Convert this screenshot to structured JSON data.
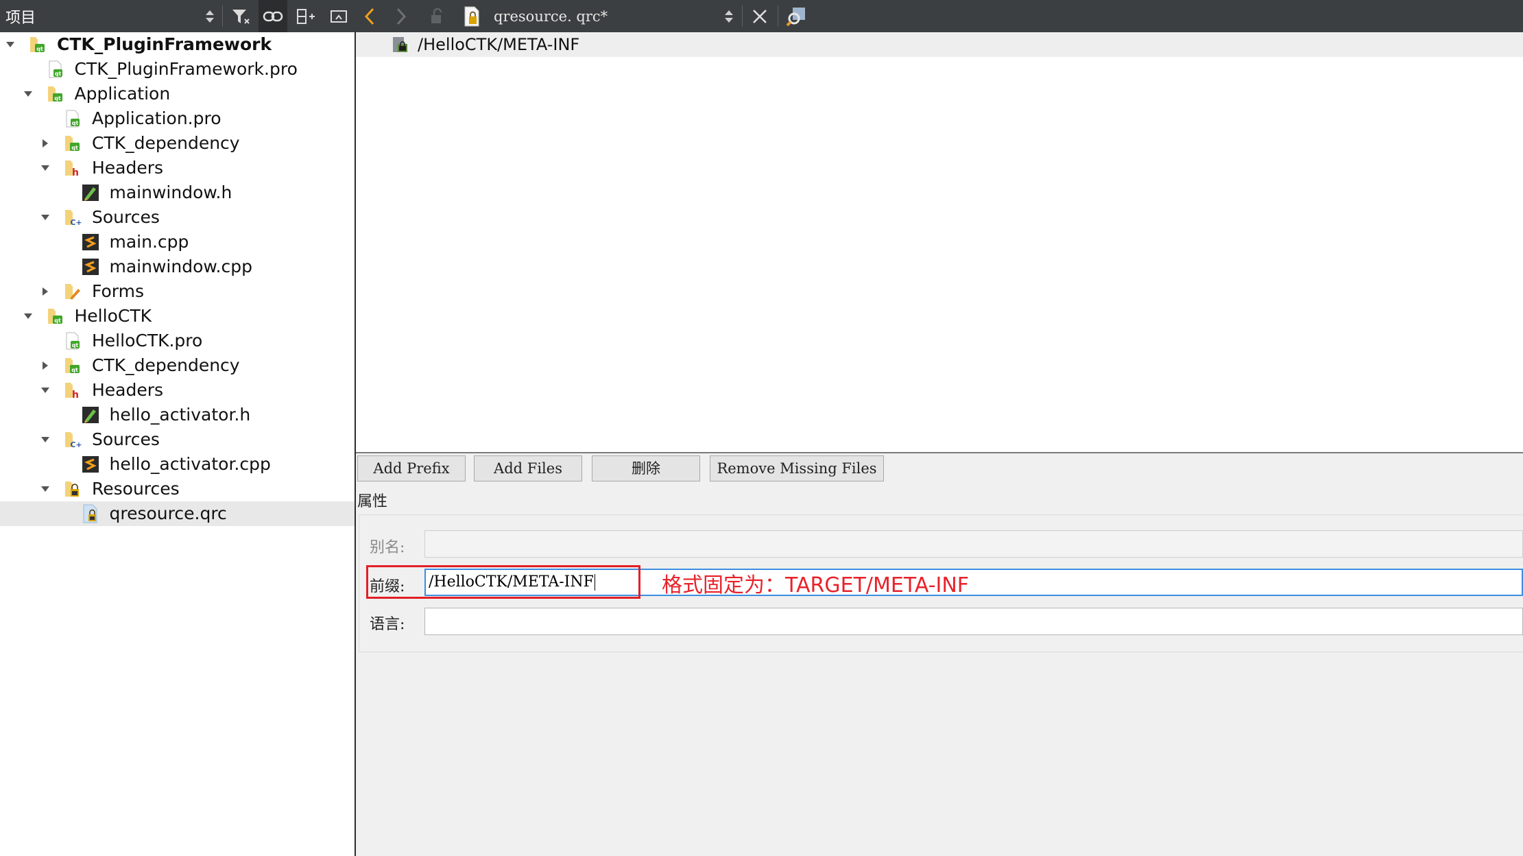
{
  "left_toolbar": {
    "title": "项目",
    "icons": [
      "sort-updown-icon",
      "filter-icon",
      "link-icon",
      "split-add-icon",
      "close-pane-icon"
    ]
  },
  "right_toolbar": {
    "file_name": "qresource. qrc*",
    "icons": [
      "back-arrow-icon",
      "forward-arrow-icon",
      "lock-icon",
      "qrc-file-icon",
      "sort-updown-icon",
      "close-icon",
      "locate-icon"
    ]
  },
  "tree": [
    {
      "label": "CTK_PluginFramework",
      "depth": 0,
      "expanded": true,
      "icon": "qt-project-folder-icon",
      "bold": true
    },
    {
      "label": "CTK_PluginFramework.pro",
      "depth": 1,
      "icon": "pro-file-icon"
    },
    {
      "label": "Application",
      "depth": 1,
      "expanded": true,
      "icon": "qt-project-folder-icon"
    },
    {
      "label": "Application.pro",
      "depth": 2,
      "icon": "pro-file-icon"
    },
    {
      "label": "CTK_dependency",
      "depth": 2,
      "expanded": false,
      "icon": "qt-project-folder-icon"
    },
    {
      "label": "Headers",
      "depth": 2,
      "expanded": true,
      "icon": "headers-folder-icon"
    },
    {
      "label": "mainwindow.h",
      "depth": 3,
      "icon": "header-file-icon"
    },
    {
      "label": "Sources",
      "depth": 2,
      "expanded": true,
      "icon": "sources-folder-icon"
    },
    {
      "label": "main.cpp",
      "depth": 3,
      "icon": "cpp-file-icon"
    },
    {
      "label": "mainwindow.cpp",
      "depth": 3,
      "icon": "cpp-file-icon"
    },
    {
      "label": "Forms",
      "depth": 2,
      "expanded": false,
      "icon": "forms-folder-icon"
    },
    {
      "label": "HelloCTK",
      "depth": 1,
      "expanded": true,
      "icon": "qt-project-folder-icon"
    },
    {
      "label": "HelloCTK.pro",
      "depth": 2,
      "icon": "pro-file-icon"
    },
    {
      "label": "CTK_dependency",
      "depth": 2,
      "expanded": false,
      "icon": "qt-project-folder-icon"
    },
    {
      "label": "Headers",
      "depth": 2,
      "expanded": true,
      "icon": "headers-folder-icon"
    },
    {
      "label": "hello_activator.h",
      "depth": 3,
      "icon": "header-file-icon"
    },
    {
      "label": "Sources",
      "depth": 2,
      "expanded": true,
      "icon": "sources-folder-icon"
    },
    {
      "label": "hello_activator.cpp",
      "depth": 3,
      "icon": "cpp-file-icon"
    },
    {
      "label": "Resources",
      "depth": 2,
      "expanded": true,
      "icon": "resources-folder-icon"
    },
    {
      "label": "qresource.qrc",
      "depth": 3,
      "icon": "qrc-file-icon",
      "selected": true
    }
  ],
  "editor": {
    "prefix_entry": "/HelloCTK/META-INF"
  },
  "buttons": {
    "add_prefix": "Add Prefix",
    "add_files": "Add Files",
    "delete": "删除",
    "remove_missing": "Remove Missing Files"
  },
  "properties": {
    "heading": "属性",
    "alias_label": "别名:",
    "alias_value": "",
    "prefix_label": "前缀:",
    "prefix_value": "/HelloCTK/META-INF",
    "language_label": "语言:",
    "language_value": ""
  },
  "annotation": {
    "text": "格式固定为：TARGET/META-INF",
    "color": "#e8222a"
  }
}
